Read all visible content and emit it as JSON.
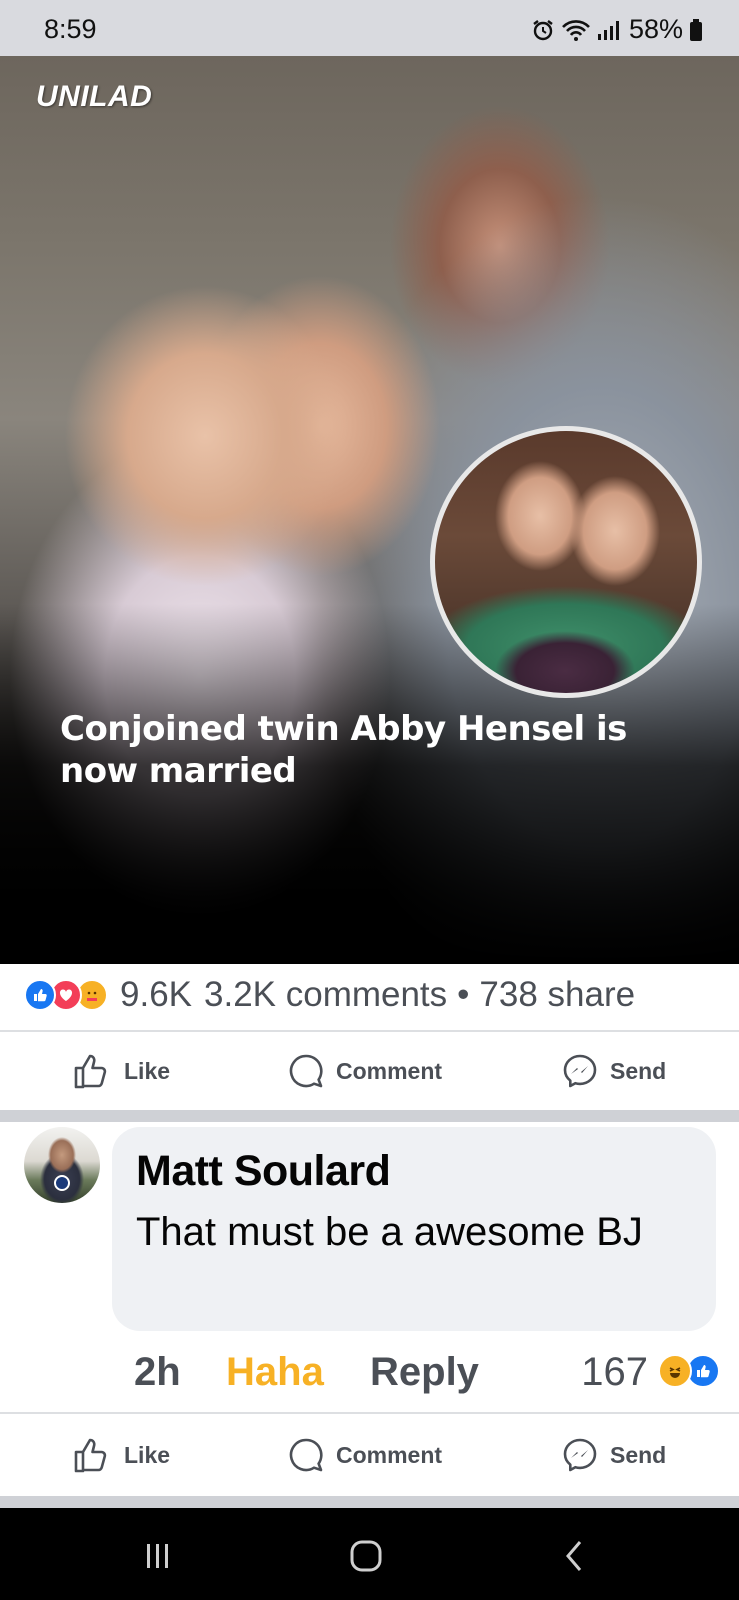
{
  "status_bar": {
    "time": "8:59",
    "battery": "58%",
    "icons": [
      "alarm-icon",
      "wifi-icon",
      "signal-icon",
      "battery-icon"
    ]
  },
  "post": {
    "brand": "UNILAD",
    "headline": "Conjoined twin Abby Hensel is now married"
  },
  "stats": {
    "reactions": [
      "like",
      "love",
      "care"
    ],
    "reaction_count": "9.6K",
    "comments": "3.2K comments",
    "separator": "•",
    "shares": "738 share"
  },
  "post_actions": {
    "like": "Like",
    "comment": "Comment",
    "send": "Send"
  },
  "comment": {
    "author": "Matt Soulard",
    "text": "That must be a awesome BJ",
    "time": "2h",
    "reaction_label": "Haha",
    "reply": "Reply",
    "reaction_count": "167",
    "reactions": [
      "haha",
      "like"
    ]
  },
  "comment_actions": {
    "like": "Like",
    "comment": "Comment",
    "send": "Send"
  },
  "colors": {
    "facebook_blue": "#1877f2",
    "haha_yellow": "#f7b125",
    "love_red": "#f33e58",
    "text_gray": "#4b4f56"
  }
}
